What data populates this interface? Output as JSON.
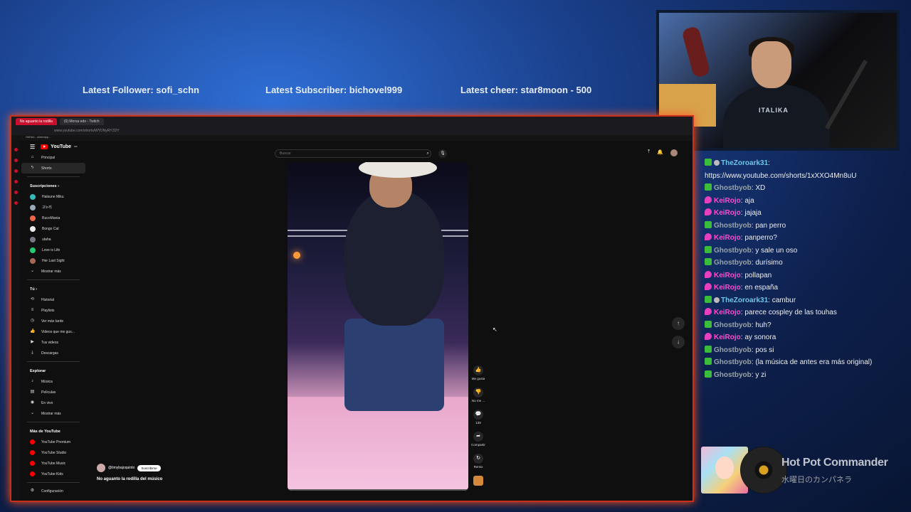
{
  "overlay": {
    "latest_follower": "Latest Follower: sofi_schn",
    "latest_subscriber": "Latest Subscriber: bichovel999",
    "latest_cheer": "Latest cheer: star8moon - 500"
  },
  "webcam": {
    "shirt_text": "ITALIKA"
  },
  "browser": {
    "tabs": [
      "No aguanto la rodilla",
      "(0) Morsa edo - Twitch"
    ],
    "address": "www.youtube.com/shorts/WYDNyRYZDY",
    "bookmark": "GitHub - wirelotpp..."
  },
  "youtube": {
    "logo": "YouTube",
    "logo_sup": "MX",
    "search_placeholder": "Buscar",
    "nav": {
      "principal": "Principal",
      "shorts": "Shorts",
      "subscriptions_header": "Suscripciones",
      "subscriptions": [
        "Hatsune Miku",
        "고누리",
        "RucoMania",
        "Bongo Cat",
        "utaha",
        "Love is Life",
        "Her Last Sight"
      ],
      "show_more": "Mostrar más",
      "you_header": "Tú",
      "you_items": [
        "Historial",
        "Playlists",
        "Ver más tarde",
        "Videos que me gus...",
        "Tus videos",
        "Descargas"
      ],
      "explore_header": "Explorar",
      "explore_items": [
        "Música",
        "Películas",
        "En vivo"
      ],
      "show_more_2": "Mostrar más",
      "more_header": "Más de YouTube",
      "more_items": [
        "YouTube Premium",
        "YouTube Studio",
        "YouTube Music",
        "YouTube Kids"
      ],
      "settings": "Configuración"
    },
    "actions": {
      "like": "Me gusta",
      "dislike": "No me ...",
      "comments": "139",
      "share": "Compartir",
      "remix": "Remix"
    },
    "channel": "@timybajoquinto",
    "subscribe": "Suscribirse",
    "video_title": "No aguanto la rodilla del músico"
  },
  "chat": {
    "messages": [
      {
        "user": "TheZoroark31",
        "text": "https://www.youtube.com/shorts/1xXXO4Mn8uU",
        "badge": "mod",
        "color": "#6ec6e8"
      },
      {
        "user": "Ghostbyob",
        "text": "XD",
        "badge": "mod",
        "color": "#9aa3a8"
      },
      {
        "user": "KeiRojo",
        "text": "aja",
        "badge": "sub",
        "color": "#ff4bd0"
      },
      {
        "user": "KeiRojo",
        "text": "jajaja",
        "badge": "sub",
        "color": "#ff4bd0"
      },
      {
        "user": "Ghostbyob",
        "text": "pan perro",
        "badge": "mod",
        "color": "#9aa3a8"
      },
      {
        "user": "KeiRojo",
        "text": "panperro?",
        "badge": "sub",
        "color": "#ff4bd0"
      },
      {
        "user": "Ghostbyob",
        "text": "y sale un oso",
        "badge": "mod",
        "color": "#9aa3a8"
      },
      {
        "user": "Ghostbyob",
        "text": "durísimo",
        "badge": "mod",
        "color": "#9aa3a8"
      },
      {
        "user": "KeiRojo",
        "text": "pollapan",
        "badge": "sub",
        "color": "#ff4bd0"
      },
      {
        "user": "KeiRojo",
        "text": "en españa",
        "badge": "sub",
        "color": "#ff4bd0"
      },
      {
        "user": "TheZoroark31",
        "text": "cambur",
        "badge": "mod",
        "color": "#6ec6e8"
      },
      {
        "user": "KeiRojo",
        "text": "parece cospley de las touhas",
        "badge": "sub",
        "color": "#ff4bd0"
      },
      {
        "user": "Ghostbyob",
        "text": "huh?",
        "badge": "mod",
        "color": "#9aa3a8"
      },
      {
        "user": "KeiRojo",
        "text": "ay sonora",
        "badge": "sub",
        "color": "#ff4bd0"
      },
      {
        "user": "Ghostbyob",
        "text": "pos si",
        "badge": "mod",
        "color": "#9aa3a8"
      },
      {
        "user": "Ghostbyob",
        "text": "(la música de antes era más original)",
        "badge": "mod",
        "color": "#9aa3a8"
      },
      {
        "user": "Ghostbyob",
        "text": "y zi",
        "badge": "mod",
        "color": "#9aa3a8"
      }
    ]
  },
  "now_playing": {
    "title": "Hot Pot Commander",
    "artist": "水曜日のカンパネラ"
  }
}
